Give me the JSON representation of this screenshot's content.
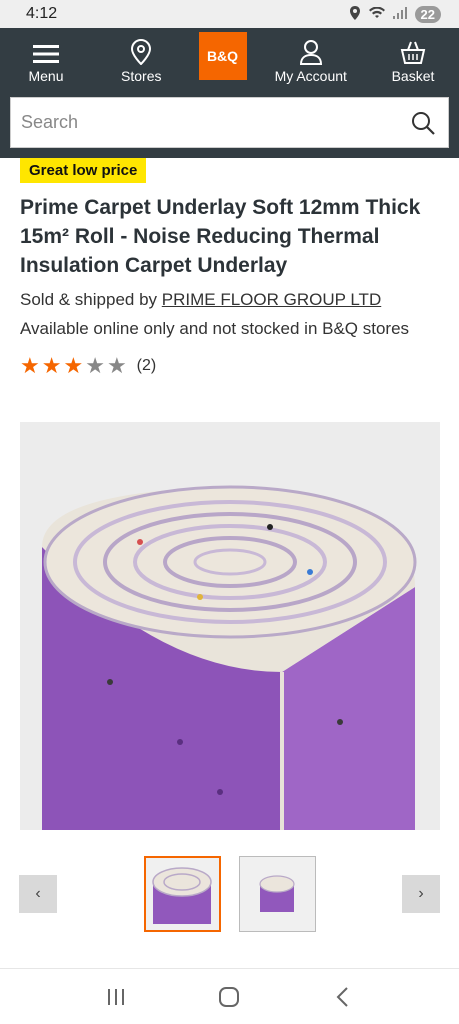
{
  "status_bar": {
    "time": "4:12",
    "notification_count": "22"
  },
  "header": {
    "menu_label": "Menu",
    "stores_label": "Stores",
    "logo_text": "B&Q",
    "account_label": "My Account",
    "basket_label": "Basket"
  },
  "search": {
    "placeholder": "Search"
  },
  "product": {
    "price_tag": "Great low price",
    "title": "Prime Carpet Underlay Soft 12mm Thick 15m² Roll - Noise Reducing Thermal Insulation Carpet Underlay",
    "sold_prefix": "Sold & shipped by ",
    "seller": "PRIME FLOOR GROUP LTD",
    "availability": "Available online only and not stocked in B&Q stores",
    "rating": 3,
    "rating_max": 5,
    "review_count": "(2)"
  },
  "gallery": {
    "prev": "‹",
    "next": "›",
    "thumb_count": 2,
    "active_thumb": 0
  },
  "colors": {
    "header": "#333d43",
    "brand_orange": "#f56600",
    "price_yellow": "#ffe600",
    "underlay_purple": "#9b5fc0"
  }
}
